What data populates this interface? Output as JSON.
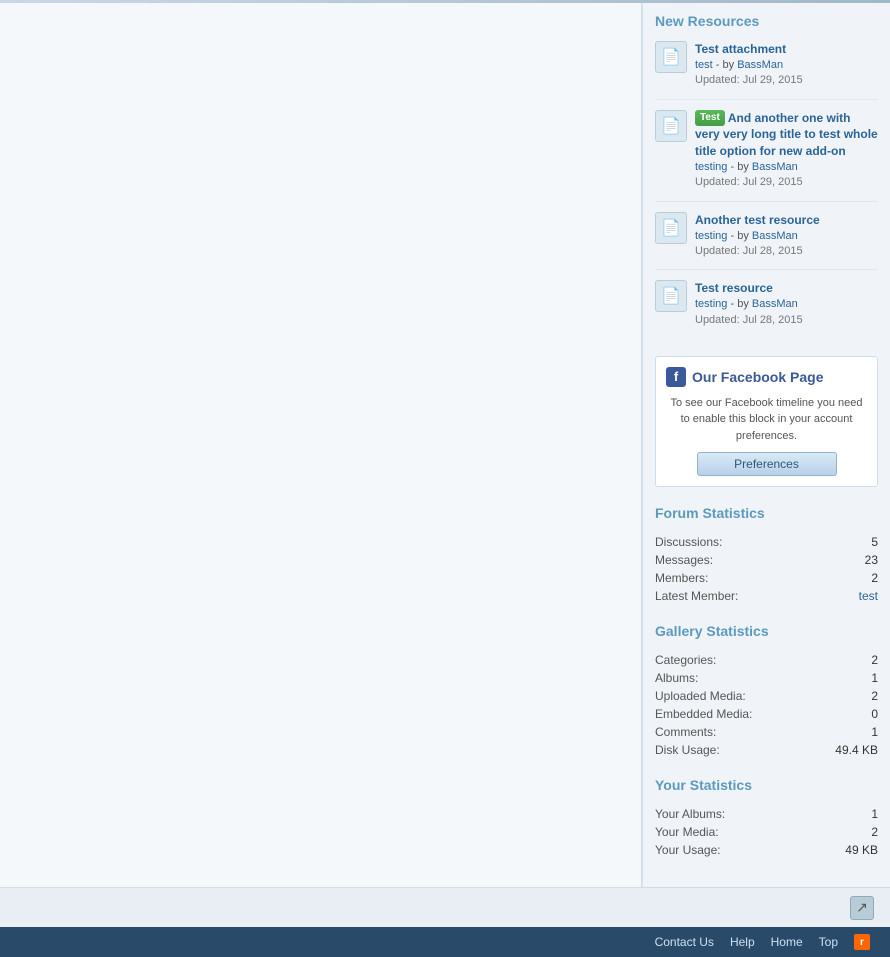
{
  "top_border": true,
  "sidebar": {
    "new_resources": {
      "title": "New Resources",
      "items": [
        {
          "id": 1,
          "title": "Test attachment",
          "category": "test",
          "author": "BassMan",
          "updated": "Updated: Jul 29, 2015",
          "tag": null
        },
        {
          "id": 2,
          "title": "And another one with very very long title to test whole title option for new add-on",
          "category": "testing",
          "author": "BassMan",
          "updated": "Updated: Jul 29, 2015",
          "tag": "Test"
        },
        {
          "id": 3,
          "title": "Another test resource",
          "category": "testing",
          "author": "BassMan",
          "updated": "Updated: Jul 28, 2015",
          "tag": null
        },
        {
          "id": 4,
          "title": "Test resource",
          "category": "testing",
          "author": "BassMan",
          "updated": "Updated: Jul 28, 2015",
          "tag": null
        }
      ]
    },
    "facebook": {
      "title": "Our Facebook Page",
      "description": "To see our Facebook timeline you need to enable this block in your account preferences.",
      "button_label": "Preferences"
    },
    "forum_stats": {
      "title": "Forum Statistics",
      "rows": [
        {
          "label": "Discussions:",
          "value": "5",
          "is_link": false
        },
        {
          "label": "Messages:",
          "value": "23",
          "is_link": false
        },
        {
          "label": "Members:",
          "value": "2",
          "is_link": false
        },
        {
          "label": "Latest Member:",
          "value": "test",
          "is_link": true
        }
      ]
    },
    "gallery_stats": {
      "title": "Gallery Statistics",
      "rows": [
        {
          "label": "Categories:",
          "value": "2",
          "is_link": false
        },
        {
          "label": "Albums:",
          "value": "1",
          "is_link": false
        },
        {
          "label": "Uploaded Media:",
          "value": "2",
          "is_link": false
        },
        {
          "label": "Embedded Media:",
          "value": "0",
          "is_link": false
        },
        {
          "label": "Comments:",
          "value": "1",
          "is_link": false
        },
        {
          "label": "Disk Usage:",
          "value": "49.4 KB",
          "is_link": false
        }
      ]
    },
    "your_stats": {
      "title": "Your Statistics",
      "rows": [
        {
          "label": "Your Albums:",
          "value": "1",
          "is_link": false
        },
        {
          "label": "Your Media:",
          "value": "2",
          "is_link": false
        },
        {
          "label": "Your Usage:",
          "value": "49 KB",
          "is_link": false
        }
      ]
    }
  },
  "footer": {
    "links": [
      "Contact Us",
      "Help",
      "Home",
      "Top"
    ],
    "contact_us": "Contact Us",
    "help": "Help",
    "home": "Home",
    "top": "Top"
  }
}
